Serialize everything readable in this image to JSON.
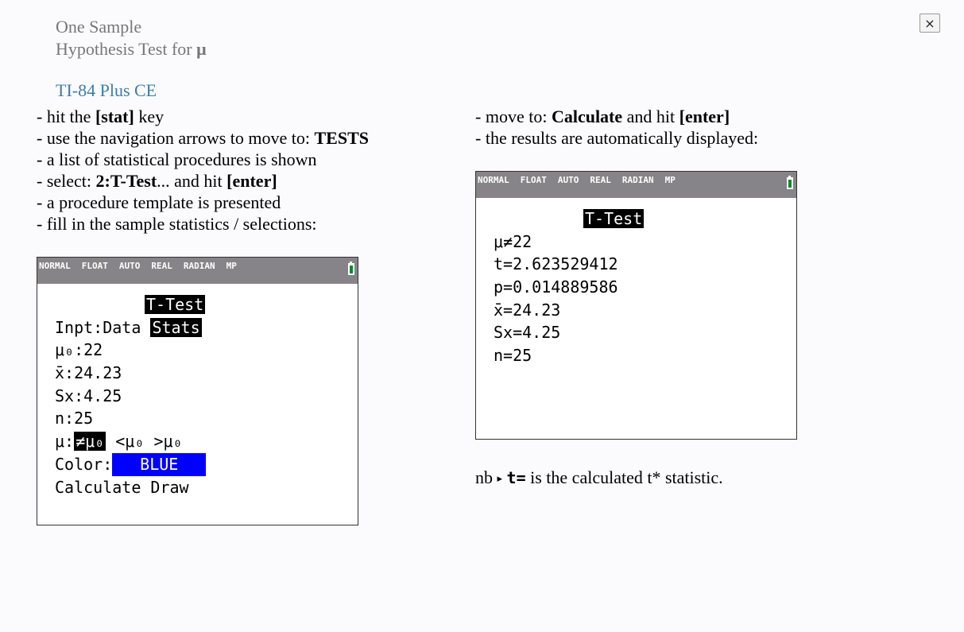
{
  "header": {
    "title_line1": "One Sample",
    "title_line2_prefix": "Hypothesis Test for ",
    "title_symbol": "μ",
    "subtitle": "TI-84 Plus CE",
    "close_label": "×"
  },
  "left_steps": [
    {
      "pre": "- hit the ",
      "bold": "[stat]",
      "post": " key"
    },
    {
      "pre": "- use the navigation arrows to move to: ",
      "bold": "TESTS",
      "post": ""
    },
    {
      "pre": "- a list of statistical procedures is shown",
      "bold": "",
      "post": ""
    },
    {
      "pre": "- select: ",
      "bold": "2:T-Test",
      "post": "...  and hit ",
      "bold2": "[enter]"
    },
    {
      "pre": "- a procedure template is presented",
      "bold": "",
      "post": ""
    },
    {
      "pre": "- fill in the sample statistics / selections:",
      "bold": "",
      "post": ""
    }
  ],
  "right_steps": [
    {
      "pre": "- move to: ",
      "bold": "Calculate",
      "post": "  and  hit ",
      "bold2": "[enter]"
    },
    {
      "pre": "- the results are automatically displayed:",
      "bold": "",
      "post": ""
    }
  ],
  "status_bar": [
    "NORMAL",
    "FLOAT",
    "AUTO",
    "REAL",
    "RADIAN",
    "MP"
  ],
  "battery_level": 1.0,
  "colors": {
    "status_bar": "#868488",
    "color_box": "#0000ff",
    "battery": "#0a8a2a",
    "subtitle": "#3d7ea6"
  },
  "input_screen": {
    "header": "T-Test",
    "inpt_label": "Inpt:",
    "inpt_data": "Data",
    "inpt_stats": "Stats",
    "mu0": "μ₀:22",
    "xbar": "x̄:24.23",
    "sx": "Sx:4.25",
    "n": "n:25",
    "alt_label": "μ:",
    "alt_selected": "≠μ₀",
    "alt_lt": "<μ₀",
    "alt_gt": ">μ₀",
    "color_label": "Color:",
    "color_value": "BLUE",
    "calculate": "Calculate",
    "draw": "Draw"
  },
  "result_screen": {
    "header": "T-Test",
    "lines": [
      "μ≠22",
      "t=2.623529412",
      "p=0.014889586",
      "x̄=24.23",
      "Sx=4.25",
      "n=25"
    ]
  },
  "note": {
    "prefix": "nb",
    "arrow": "▸",
    "code": "t=",
    "text": " is the calculated t* statistic."
  }
}
